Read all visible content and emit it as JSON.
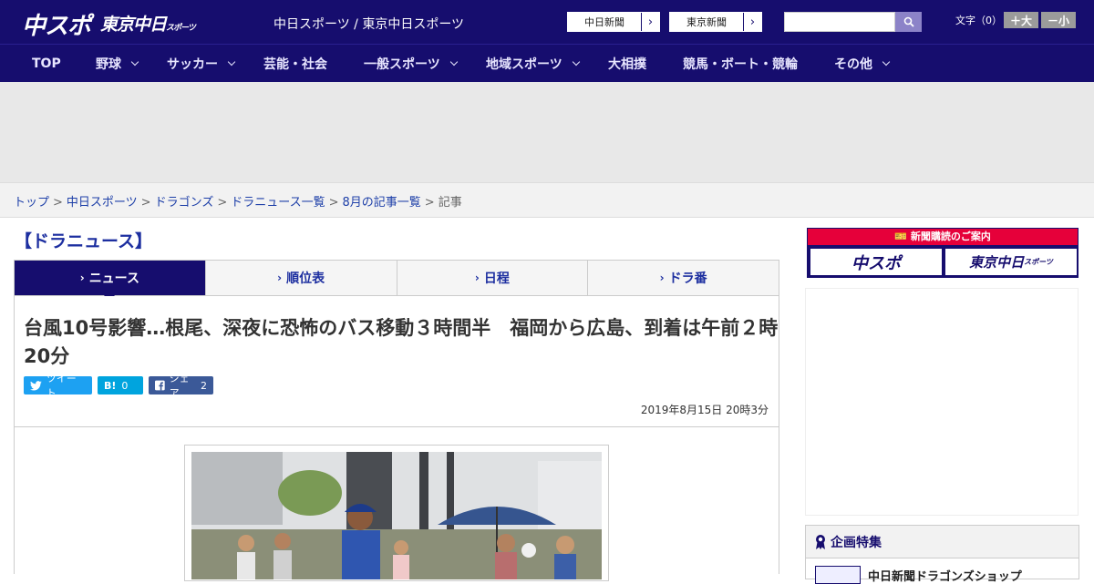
{
  "header": {
    "logo_chunichi": "中スポ",
    "logo_tokyo": "東京中日",
    "logo_tokyo_small": "スポーツ",
    "site_names": "中日スポーツ / 東京中日スポーツ",
    "links": [
      {
        "label": "中日新聞"
      },
      {
        "label": "東京新聞"
      }
    ],
    "search_placeholder": "",
    "font_size_label": "文字（0）",
    "font_larger": "＋大",
    "font_smaller": "－小"
  },
  "nav": {
    "items": [
      {
        "label": "TOP",
        "dropdown": false
      },
      {
        "label": "野球",
        "dropdown": true
      },
      {
        "label": "サッカー",
        "dropdown": true
      },
      {
        "label": "芸能・社会",
        "dropdown": false
      },
      {
        "label": "一般スポーツ",
        "dropdown": true
      },
      {
        "label": "地域スポーツ",
        "dropdown": true
      },
      {
        "label": "大相撲",
        "dropdown": false
      },
      {
        "label": "競馬・ボート・競輪",
        "dropdown": false
      },
      {
        "label": "その他",
        "dropdown": true
      }
    ]
  },
  "breadcrumb": {
    "items": [
      "トップ",
      "中日スポーツ",
      "ドラゴンズ",
      "ドラニュース一覧",
      "8月の記事一覧"
    ],
    "current": "記事",
    "separator": ">"
  },
  "section_title": "【ドラニュース】",
  "tabs": [
    {
      "label": "ニュース",
      "active": true
    },
    {
      "label": "順位表",
      "active": false
    },
    {
      "label": "日程",
      "active": false
    },
    {
      "label": "ドラ番",
      "active": false
    }
  ],
  "article": {
    "headline": "台風10号影響…根尾、深夜に恐怖のバス移動３時間半　福岡から広島、到着は午前２時20分",
    "share": {
      "tweet": "ツイート",
      "hatena_label": "B!",
      "hatena_count": "0",
      "facebook_label": "シェア",
      "facebook_count": "2"
    },
    "date": "2019年8月15日 20時3分"
  },
  "sidebar": {
    "subscribe_header": "新聞購読のご案内",
    "subscribe_chunichi": "中スポ",
    "subscribe_tokyo": "東京中日",
    "subscribe_tokyo_small": "スポーツ",
    "kikaku_title": "企画特集",
    "kikaku_item": "中日新聞ドラゴンズショップ"
  },
  "colors": {
    "brand": "#160d6e",
    "accent_red": "#e6003a",
    "twitter": "#1da1f2",
    "hatena": "#00a4de",
    "facebook": "#3b5998"
  }
}
